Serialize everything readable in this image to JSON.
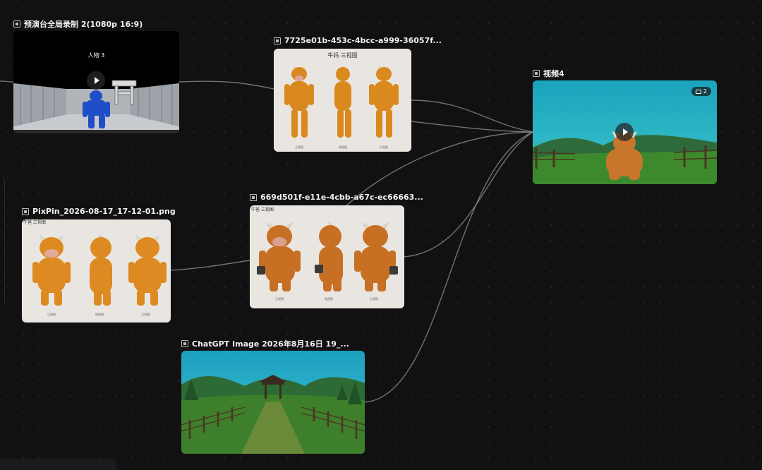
{
  "nodes": {
    "rehearsal": {
      "title": "预演台全局录制 2(1080p 16:9)",
      "overlay": "人物 3"
    },
    "sheet1": {
      "title": "7725e01b-453c-4bcc-a999-36057f...",
      "label": "牛妈 三视图",
      "captions": [
        "正视图",
        "侧视图",
        "后视图"
      ]
    },
    "video4": {
      "title": "视频4",
      "badge": "2"
    },
    "pixpin": {
      "title": "PixPin_2026-08-17_17-12-01.png",
      "label": "牛爸 三视图",
      "captions": [
        "正视图",
        "侧视图",
        "后视图"
      ]
    },
    "sheet2": {
      "title": "669d501f-e11e-4cbb-a67c-ec66663...",
      "label": "牛爸 三视图",
      "captions": [
        "正视图",
        "侧视图",
        "后视图"
      ]
    },
    "chatgpt": {
      "title": "ChatGPT Image 2026年8月16日 19_..."
    }
  },
  "icons": {
    "node_type": "image-node-icon",
    "play": "play-icon",
    "badge": "stack-icon"
  },
  "colors": {
    "background": "#111112",
    "edge": "#8a8a8a",
    "bull": "#d9891e",
    "sky": "#22b3c7",
    "grass": "#3d7a2a"
  }
}
